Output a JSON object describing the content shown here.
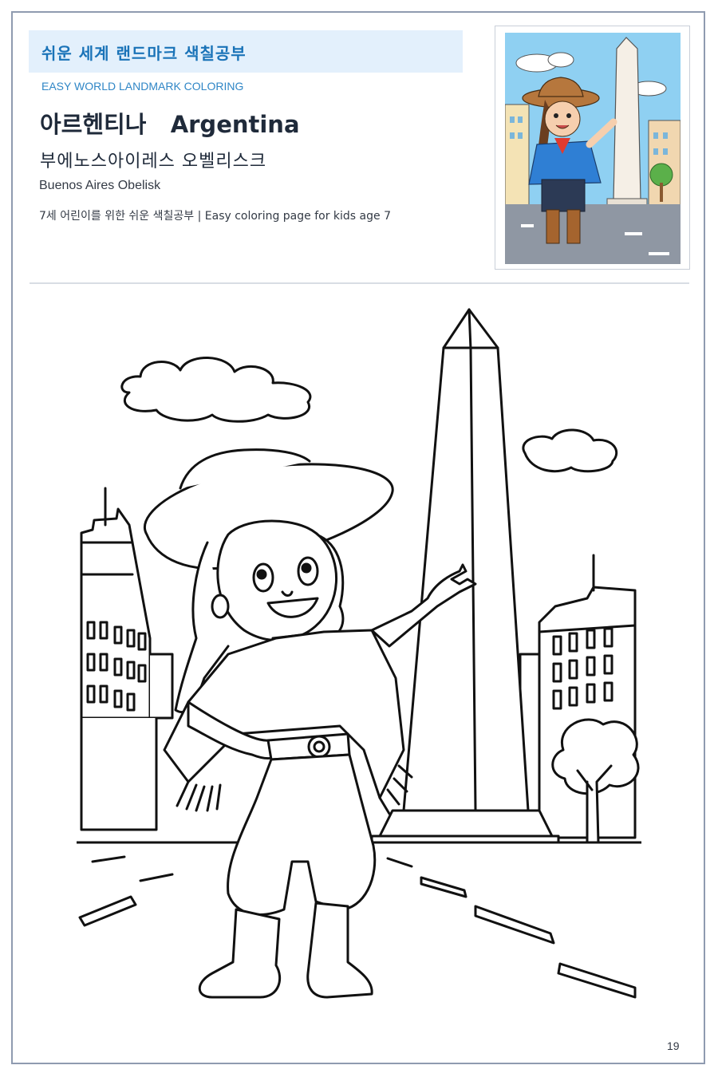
{
  "header": {
    "series_title_ko": "쉬운 세계 랜드마크 색칠공부",
    "series_title_en": "EASY WORLD LANDMARK COLORING",
    "country": "아르헨티나   Argentina",
    "landmark_ko": "부에노스아이레스 오벨리스크",
    "landmark_en": "Buenos Aires Obelisk",
    "age_note": "7세 어린이를 위한 쉬운 색칠공부 | Easy coloring page for kids age 7"
  },
  "colors": {
    "title_band_bg": "#e3f0fc",
    "title_text": "#1a73b8",
    "border": "#8f9bb0"
  },
  "footer": {
    "page_number": "19"
  }
}
